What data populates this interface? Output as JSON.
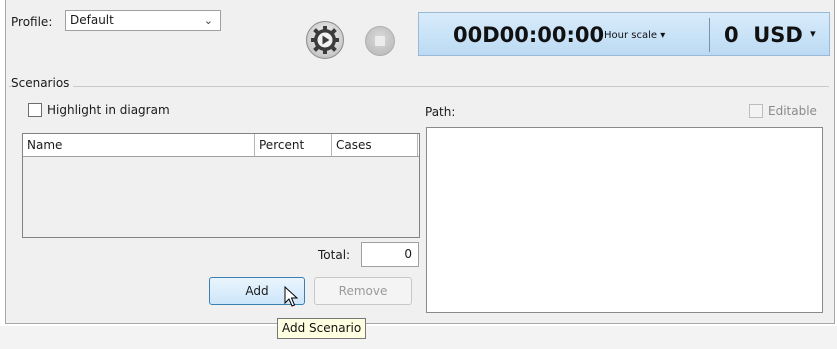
{
  "toolbar": {
    "profile_label": "Profile:",
    "profile_value": "Default",
    "timer": "00D00:00:00",
    "hour_scale": "Hour scale ▾",
    "cost_value": "0",
    "cost_currency": "USD",
    "cost_arrow": "▾"
  },
  "scenarios": {
    "group_title": "Scenarios",
    "highlight_label": "Highlight in diagram",
    "highlight_checked": false,
    "table": {
      "columns": [
        "Name",
        "Percent",
        "Cases"
      ],
      "rows": []
    },
    "total_label": "Total:",
    "total_value": "0",
    "add_label": "Add",
    "remove_label": "Remove"
  },
  "path": {
    "label": "Path:",
    "editable_label": "Editable",
    "editable_checked": false,
    "editable_enabled": false
  },
  "tooltip": {
    "text": "Add Scenario"
  },
  "colors": {
    "clock_background": "#c9e3f7",
    "panel_background": "#f0f0f0",
    "tooltip_background": "#ffffe1",
    "primary_button_border": "#3c7fb1"
  }
}
